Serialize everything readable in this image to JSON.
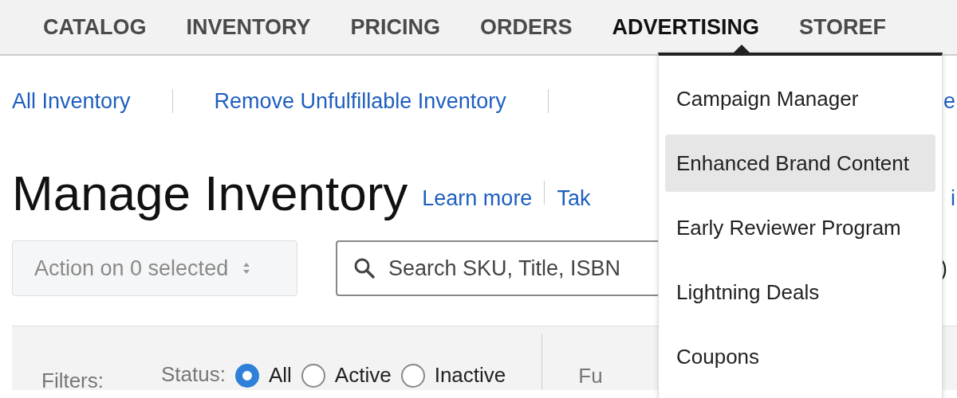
{
  "nav": {
    "items": [
      {
        "label": "CATALOG",
        "selected": false
      },
      {
        "label": "INVENTORY",
        "selected": false
      },
      {
        "label": "PRICING",
        "selected": false
      },
      {
        "label": "ORDERS",
        "selected": false
      },
      {
        "label": "ADVERTISING",
        "selected": true
      },
      {
        "label": "STOREF",
        "selected": false
      }
    ]
  },
  "dropdown": {
    "items": [
      {
        "label": "Campaign Manager",
        "highlighted": false
      },
      {
        "label": "Enhanced Brand Content",
        "highlighted": true
      },
      {
        "label": "Early Reviewer Program",
        "highlighted": false
      },
      {
        "label": "Lightning Deals",
        "highlighted": false
      },
      {
        "label": "Coupons",
        "highlighted": false
      }
    ]
  },
  "subnav": {
    "links": [
      "All Inventory",
      "Remove Unfulfillable Inventory"
    ],
    "cut_text": "e"
  },
  "header": {
    "title": "Manage Inventory",
    "links": [
      "Learn more",
      "Tak"
    ],
    "cut_text": "i"
  },
  "toolbar": {
    "action_select": "Action on 0 selected",
    "search": {
      "placeholder": "Search SKU, Title, ISBN"
    },
    "cut_text": ")"
  },
  "filters": {
    "label": "Filters:",
    "status": {
      "label": "Status:",
      "options": [
        {
          "label": "All",
          "selected": true
        },
        {
          "label": "Active",
          "selected": false
        },
        {
          "label": "Inactive",
          "selected": false
        }
      ]
    },
    "next_label": "Fu"
  }
}
